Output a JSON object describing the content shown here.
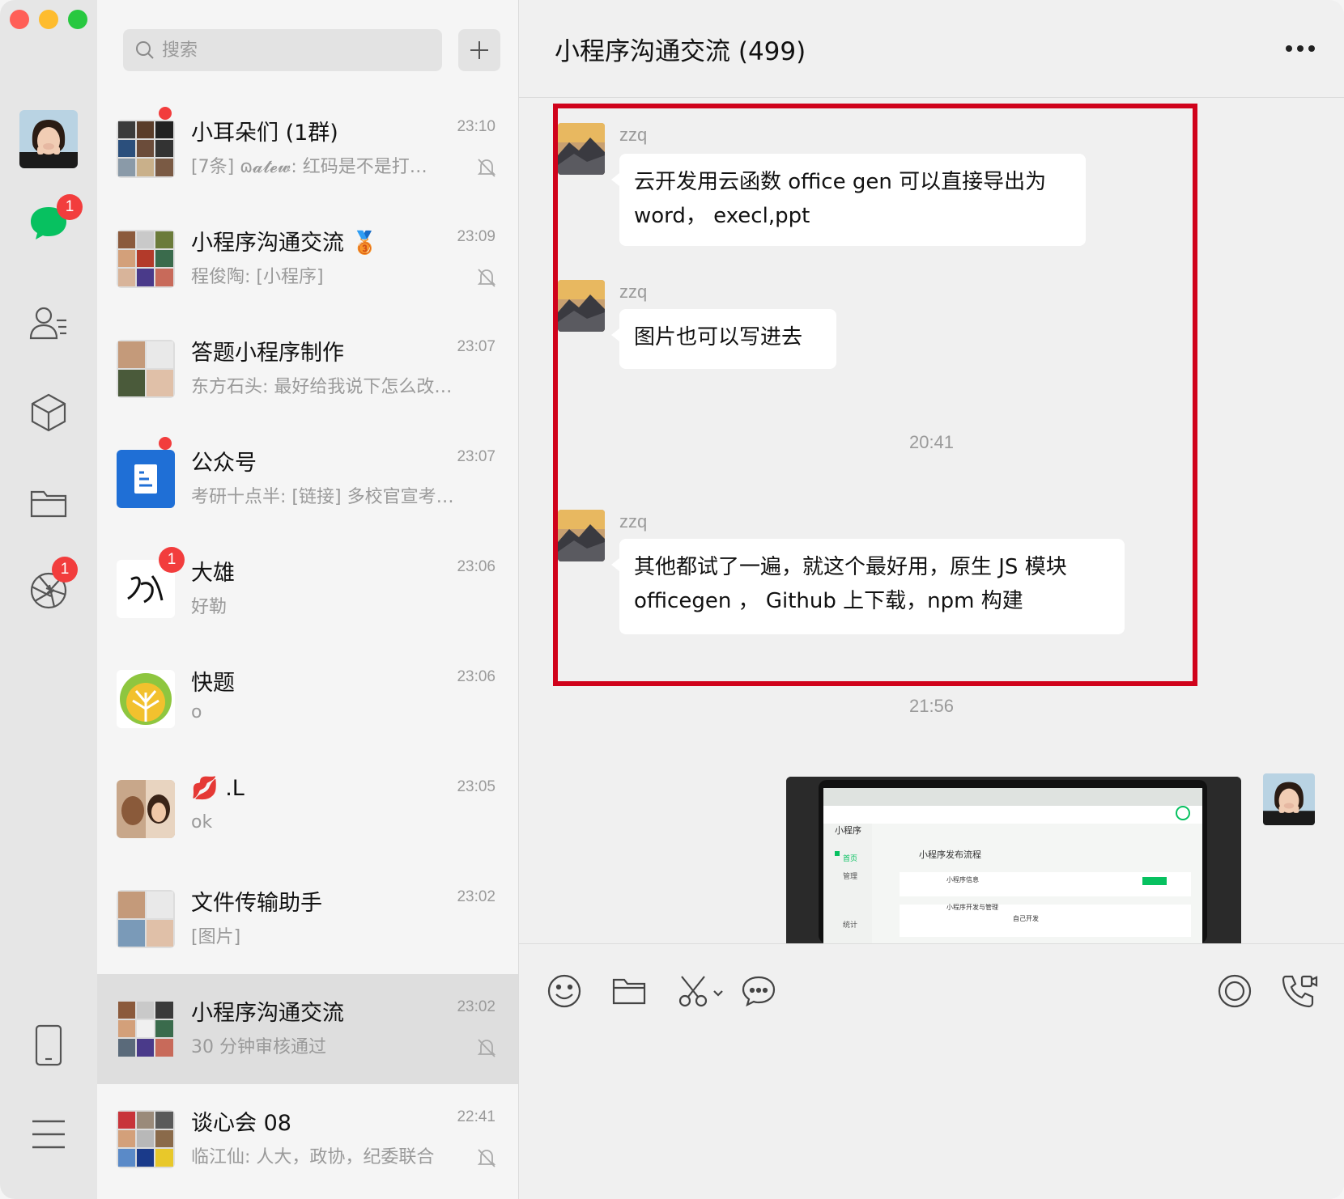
{
  "rail": {
    "chat_badge": "1",
    "moments_badge": "1"
  },
  "search": {
    "placeholder": "搜索"
  },
  "conversations": [
    {
      "name": "小耳朵们 (1群)",
      "time": "23:10",
      "preview": "[7条] ɷ𝓪𝓽𝓮𝔀: 红码是不是打…",
      "muted": true,
      "unread_dot": true
    },
    {
      "name": "小程序沟通交流 🥉",
      "time": "23:09",
      "preview": "程俊陶: [小程序]",
      "muted": true
    },
    {
      "name": "答题小程序制作",
      "time": "23:07",
      "preview": "东方石头: 最好给我说下怎么改…"
    },
    {
      "name": "公众号",
      "time": "23:07",
      "preview": "考研十点半: [链接] 多校官宣考…",
      "unread_dot": true
    },
    {
      "name": "大雄",
      "time": "23:06",
      "preview": "好勒",
      "badge": "1"
    },
    {
      "name": "快题",
      "time": "23:06",
      "preview": "o"
    },
    {
      "name": "💋 .L",
      "time": "23:05",
      "preview": "ok"
    },
    {
      "name": "文件传输助手",
      "time": "23:02",
      "preview": "[图片]"
    },
    {
      "name": "小程序沟通交流",
      "time": "23:02",
      "preview": "30 分钟审核通过",
      "muted": true,
      "active": true
    },
    {
      "name": "谈心会 08",
      "time": "22:41",
      "preview": "临江仙: 人大，政协，纪委联合",
      "muted": true
    }
  ],
  "chat": {
    "title": "小程序沟通交流 (499)",
    "messages": [
      {
        "sender": "zzq",
        "text_line1": "云开发用云函数 office gen 可以直接导出为",
        "text_line2": "word，  execl,ppt"
      },
      {
        "sender": "zzq",
        "text_line1": "图片也可以写进去"
      },
      {
        "sender": "zzq",
        "text_line1": "其他都试了一遍，就这个最好用，原生 JS 模块",
        "text_line2": "officegen ，  Github 上下载，npm 构建"
      }
    ],
    "timestamps": [
      "20:41",
      "21:56"
    ],
    "screenshot_text": {
      "app_name": "小程序",
      "page_heading": "小程序发布流程",
      "menu_home": "首页",
      "menu_manage": "管理",
      "menu_stats": "统计",
      "row1": "小程序信息",
      "row2": "小程序开发与管理",
      "row2_sub": "自己开发"
    }
  },
  "colors": {
    "accent_red": "#d0021b",
    "badge_red": "#f23d3d",
    "wechat_green": "#07c160"
  }
}
